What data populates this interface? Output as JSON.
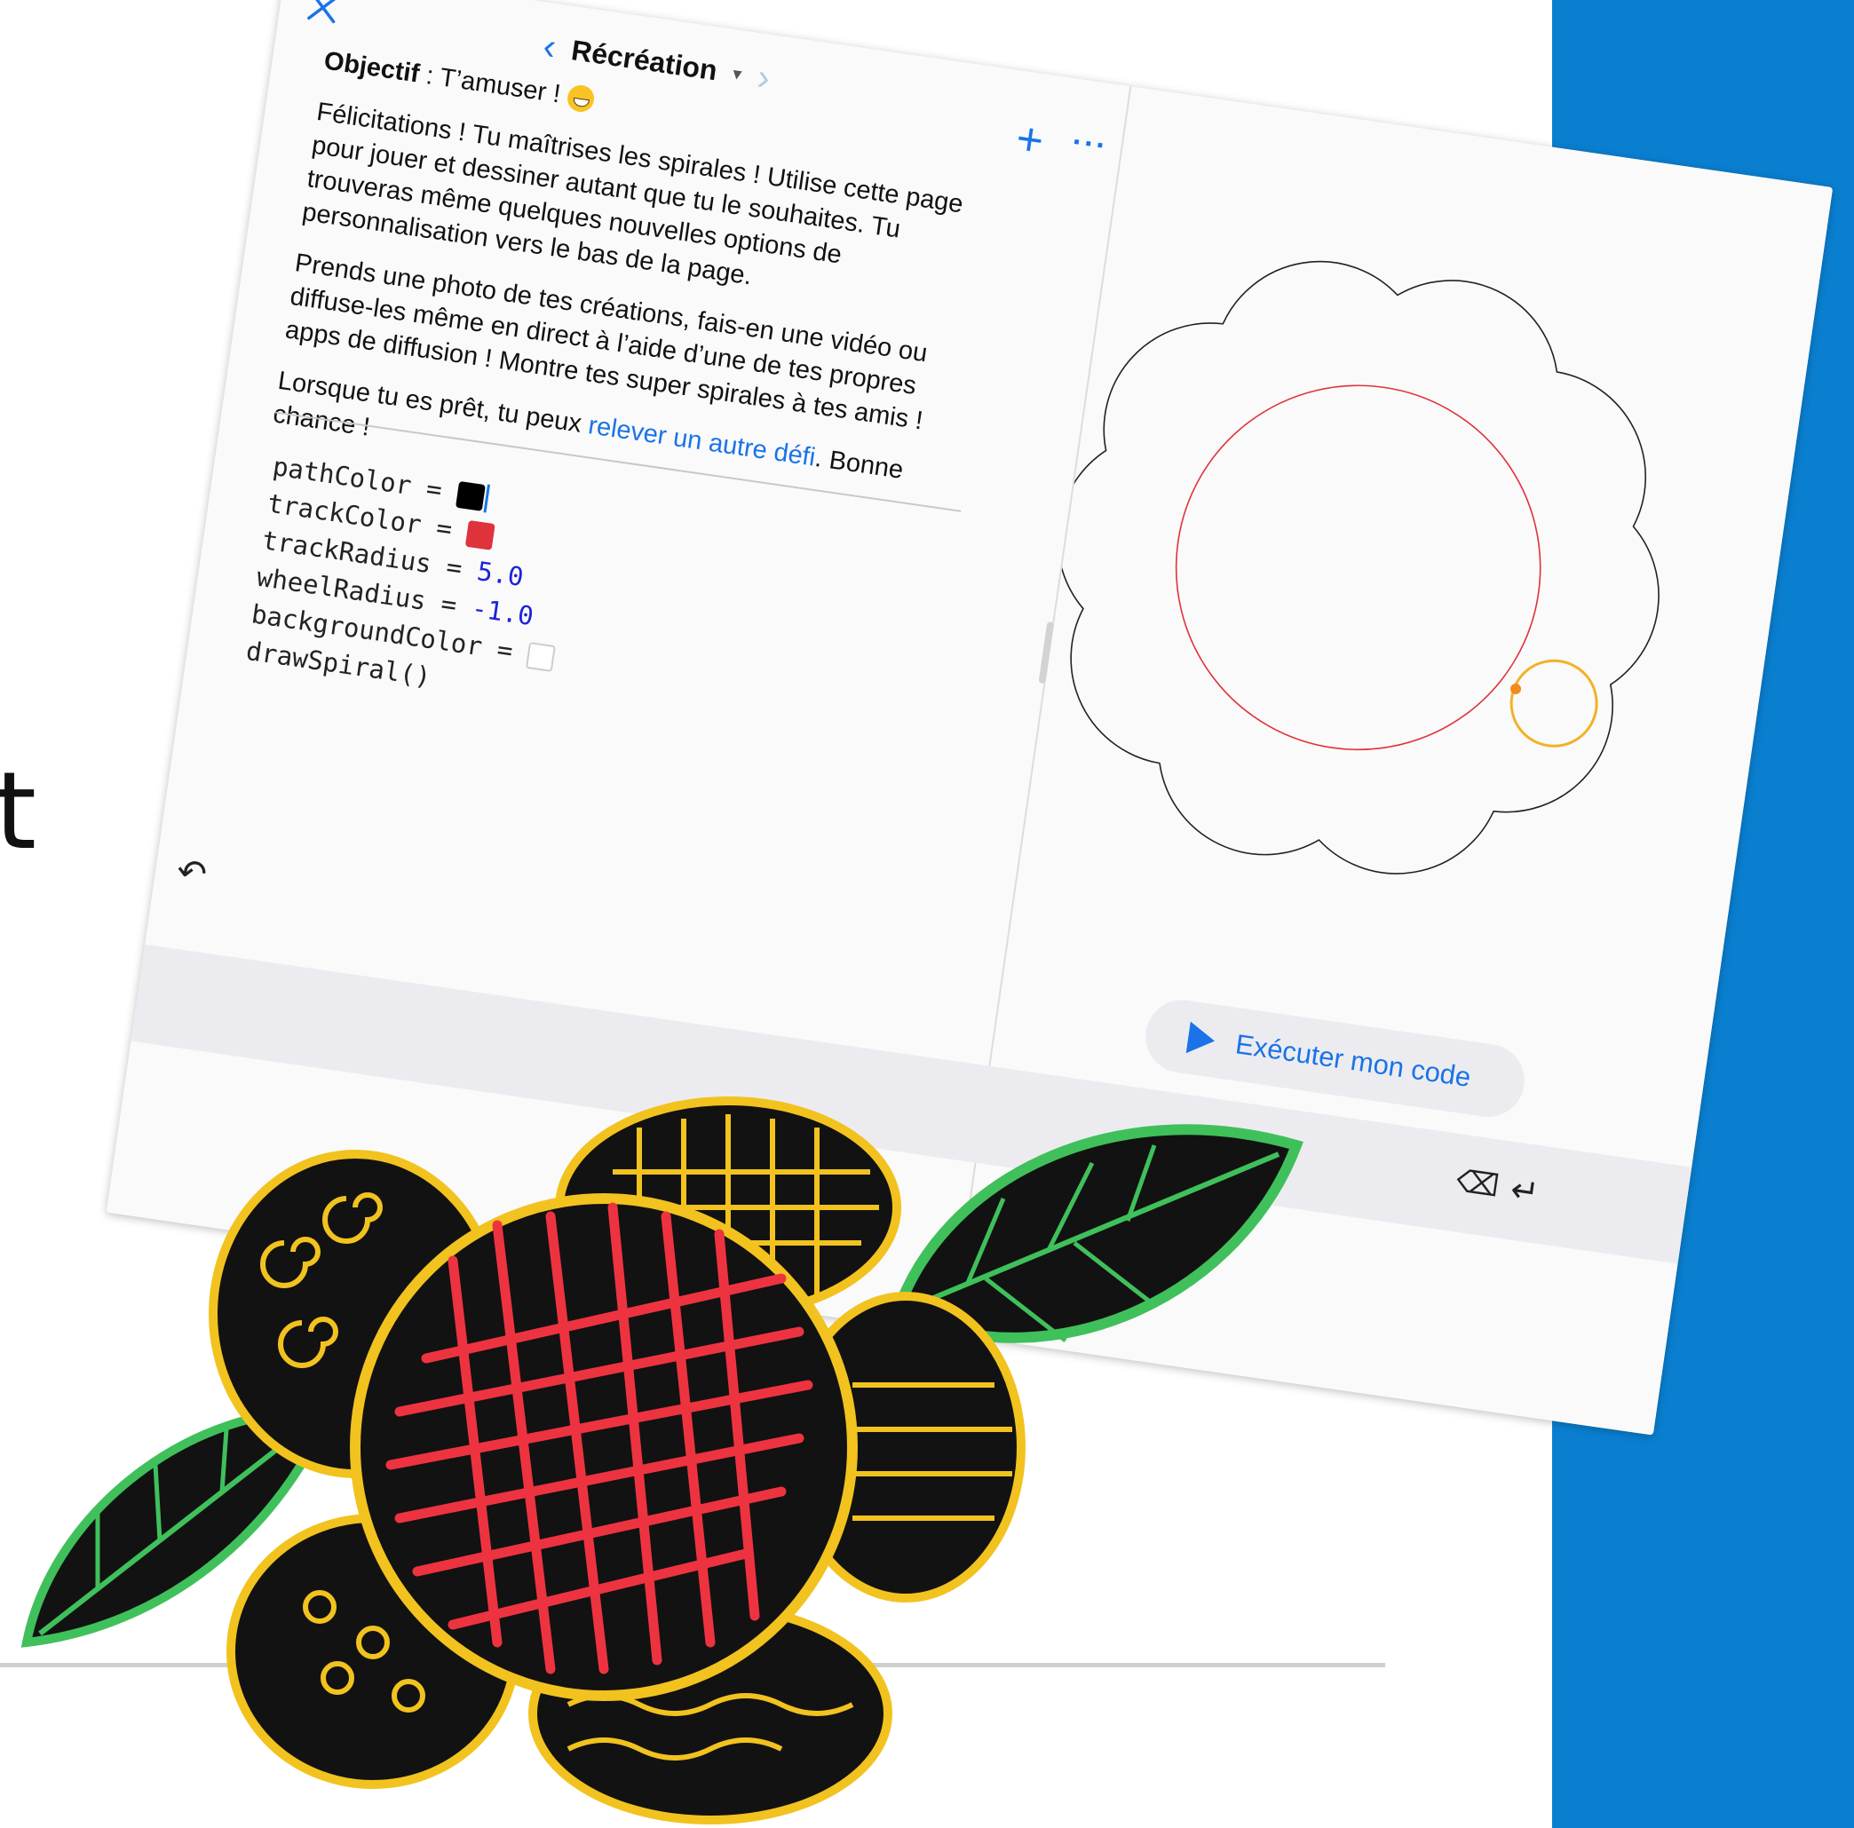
{
  "background": {
    "glyph": "t"
  },
  "header": {
    "title": "Récréation",
    "back_icon": "chevron-left-icon",
    "forward_icon": "chevron-right-icon",
    "close_icon": "close-icon",
    "add_icon": "plus-icon",
    "more_icon": "more-icon"
  },
  "content": {
    "goal_label": "Objectif",
    "goal_text": " : T’amuser ! ",
    "p1": "Félicitations ! Tu maîtrises les spirales ! Utilise cette page pour jouer et dessiner autant que tu le souhaites. Tu trouveras même quelques nouvelles options de personnalisation vers le bas de la page.",
    "p2": "Prends une photo de tes créations, fais-en une vidéo ou diffuse-les même en direct à l’aide d’une de tes propres apps de diffusion ! Montre tes super spirales à tes amis !",
    "p3_before": "Lorsque tu es prêt, tu peux ",
    "p3_link": "relever un autre défi",
    "p3_after": ". Bonne chance !"
  },
  "code": {
    "line1_var": "pathColor =",
    "line2_var": "trackColor =",
    "line3_var": "trackRadius =",
    "line3_val": "5.0",
    "line4_var": "wheelRadius =",
    "line4_val": "-1.0",
    "line5_var": "backgroundColor =",
    "line6": "drawSpiral()"
  },
  "colors": {
    "pathColor": "#000000",
    "trackColor": "#e0323b",
    "backgroundColor": "#ffffff",
    "accent": "#1a73e8",
    "banner": "#0a7fd0"
  },
  "toolbar": {
    "run_label": "Exécuter mon code",
    "undo_icon": "undo-icon",
    "backspace_icon": "backspace-icon",
    "return_icon": "return-icon"
  }
}
